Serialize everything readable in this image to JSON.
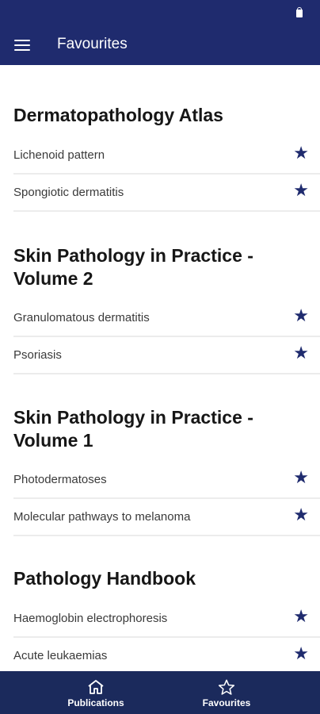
{
  "header": {
    "title": "Favourites"
  },
  "sections": [
    {
      "title": "Dermatopathology Atlas",
      "items": [
        "Lichenoid pattern",
        "Spongiotic dermatitis"
      ]
    },
    {
      "title_line1": "Skin Pathology in Practice -",
      "title_line2": "Volume 2",
      "items": [
        "Granulomatous dermatitis",
        "Psoriasis"
      ]
    },
    {
      "title_line1": "Skin Pathology in Practice -",
      "title_line2": "Volume 1",
      "items": [
        "Photodermatoses",
        "Molecular pathways to melanoma"
      ]
    },
    {
      "title": "Pathology Handbook",
      "items": [
        "Haemoglobin electrophoresis",
        "Acute leukaemias"
      ]
    }
  ],
  "favourite_glyph": "★",
  "bottom_nav": [
    {
      "label": "Publications",
      "icon": "home-icon"
    },
    {
      "label": "Favourites",
      "icon": "star-outline-icon"
    }
  ],
  "colors": {
    "appbar": "#1f2b6e",
    "bottom_nav": "#1b2a5c",
    "star": "#1f2b6e"
  }
}
